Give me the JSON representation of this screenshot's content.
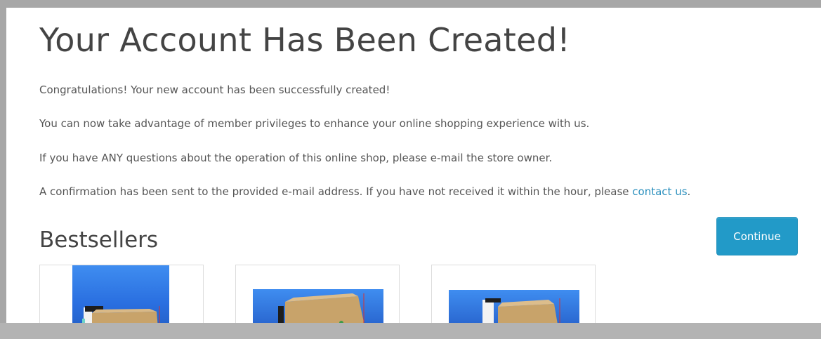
{
  "page": {
    "title": "Your Account Has Been Created!",
    "messages": {
      "p1": "Congratulations! Your new account has been successfully created!",
      "p2": "You can now take advantage of member privileges to enhance your online shopping experience with us.",
      "p3": "If you have ANY questions about the operation of this online shop, please e-mail the store owner.",
      "p4_text": "A confirmation has been sent to the provided e-mail address. If you have not received it within the hour, please ",
      "p4_link": "contact us",
      "p4_end": "."
    },
    "continue_label": "Continue"
  },
  "bestsellers": {
    "title": "Bestsellers",
    "products": [
      {
        "image": "product-photo-box-blue-background"
      },
      {
        "image": "product-photo-box-blue-background"
      },
      {
        "image": "product-photo-box-blue-background"
      }
    ]
  },
  "colors": {
    "link": "#2a8fbd",
    "button": "#229ac8",
    "image_sky": "#2c6fe0",
    "box": "#c8a36a"
  }
}
